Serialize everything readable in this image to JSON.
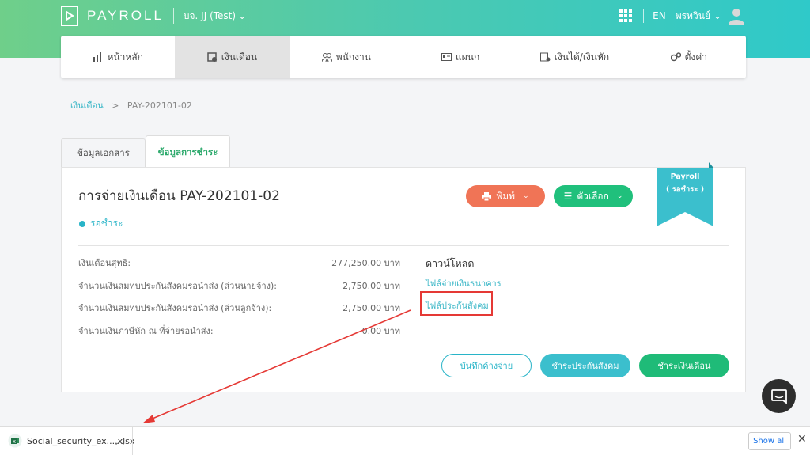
{
  "header": {
    "brand": "PAYROLL",
    "company": "บจ. JJ (Test)",
    "language": "EN",
    "user": "พรทวินย์"
  },
  "nav": [
    {
      "label": "หน้าหลัก",
      "icon": "chart-icon"
    },
    {
      "label": "เงินเดือน",
      "icon": "payroll-icon",
      "active": true
    },
    {
      "label": "พนักงาน",
      "icon": "people-icon"
    },
    {
      "label": "แผนก",
      "icon": "department-icon"
    },
    {
      "label": "เงินได้/เงินหัก",
      "icon": "income-icon"
    },
    {
      "label": "ตั้งค่า",
      "icon": "gears-icon"
    }
  ],
  "breadcrumb": {
    "parent": "เงินเดือน",
    "current": "PAY-202101-02"
  },
  "tabs": [
    "ข้อมูลเอกสาร",
    "ข้อมูลการชำระ"
  ],
  "card": {
    "title": "การจ่ายเงินเดือน PAY-202101-02",
    "status": "รอชำระ",
    "print_label": "พิมพ์",
    "options_label": "ตัวเลือก",
    "ribbon_line1": "Payroll",
    "ribbon_line2": "( รอชำระ )",
    "rows": [
      {
        "label": "เงินเดือนสุทธิ:",
        "value": "277,250.00 บาท"
      },
      {
        "label": "จำนวนเงินสมทบประกันสังคมรอนำส่ง (ส่วนนายจ้าง):",
        "value": "2,750.00 บาท"
      },
      {
        "label": "จำนวนเงินสมทบประกันสังคมรอนำส่ง (ส่วนลูกจ้าง):",
        "value": "2,750.00 บาท"
      },
      {
        "label": "จำนวนเงินภาษีหัก ณ ที่จ่ายรอนำส่ง:",
        "value": "0.00 บาท"
      }
    ],
    "download_title": "ดาวน์โหลด",
    "download_bank": "ไฟล์จ่ายเงินธนาคาร",
    "download_ss": "ไฟล์ประกันสังคม",
    "btn_record": "บันทึกค้างจ่าย",
    "btn_pay_ss": "ชำระประกันสังคม",
    "btn_pay_salary": "ชำระเงินเดือน"
  },
  "downloads_bar": {
    "file": "Social_security_ex....xlsx",
    "show_all": "Show all"
  },
  "colors": {
    "accent_green": "#20c07c",
    "accent_teal": "#3bbfcd",
    "print_orange": "#f07456",
    "highlight_red": "#e53935"
  }
}
